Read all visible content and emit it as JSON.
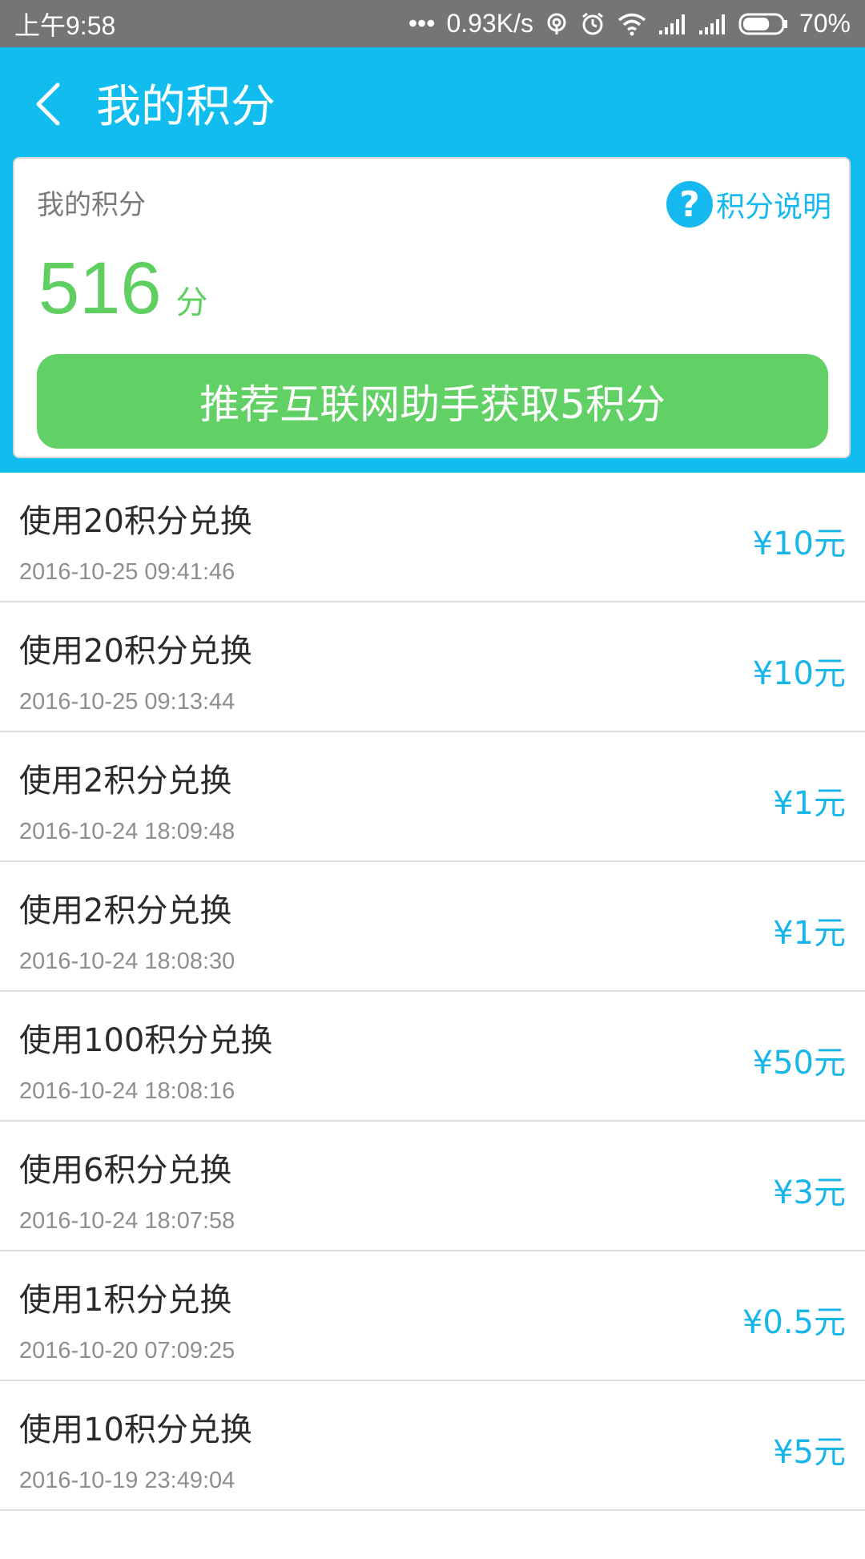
{
  "status_bar": {
    "time": "上午9:58",
    "dots": "•••",
    "speed": "0.93K/s",
    "battery": "70%",
    "battery_level": 0.7
  },
  "header": {
    "title": "我的积分"
  },
  "card": {
    "label": "我的积分",
    "help_label": "积分说明",
    "help_icon": "?",
    "points": "516",
    "points_unit": "分",
    "promo_button": "推荐互联网助手获取5积分"
  },
  "records": [
    {
      "title": "使用20积分兑换",
      "date": "2016-10-25 09:41:46",
      "amount": "¥10元"
    },
    {
      "title": "使用20积分兑换",
      "date": "2016-10-25 09:13:44",
      "amount": "¥10元"
    },
    {
      "title": "使用2积分兑换",
      "date": "2016-10-24 18:09:48",
      "amount": "¥1元"
    },
    {
      "title": "使用2积分兑换",
      "date": "2016-10-24 18:08:30",
      "amount": "¥1元"
    },
    {
      "title": "使用100积分兑换",
      "date": "2016-10-24 18:08:16",
      "amount": "¥50元"
    },
    {
      "title": "使用6积分兑换",
      "date": "2016-10-24 18:07:58",
      "amount": "¥3元"
    },
    {
      "title": "使用1积分兑换",
      "date": "2016-10-20 07:09:25",
      "amount": "¥0.5元"
    },
    {
      "title": "使用10积分兑换",
      "date": "2016-10-19 23:49:04",
      "amount": "¥5元"
    }
  ],
  "colors": {
    "header_bg": "#10bdee",
    "accent_blue": "#17b5e8",
    "points_green": "#5fcf61",
    "button_green": "#62d165"
  }
}
